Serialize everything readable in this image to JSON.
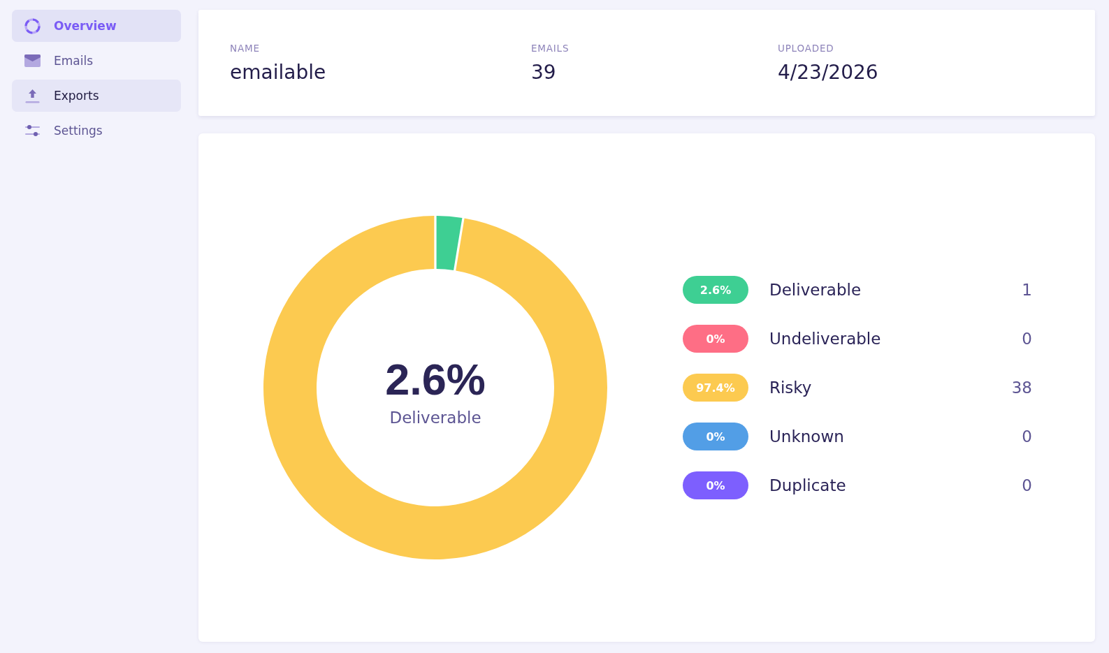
{
  "sidebar": {
    "items": [
      {
        "label": "Overview",
        "kind": "ring",
        "selected": true,
        "hovered": false
      },
      {
        "label": "Emails",
        "kind": "envelope",
        "selected": false,
        "hovered": false
      },
      {
        "label": "Exports",
        "kind": "upload",
        "selected": false,
        "hovered": true
      },
      {
        "label": "Settings",
        "kind": "sliders",
        "selected": false,
        "hovered": false
      }
    ]
  },
  "summary": {
    "fields": [
      {
        "label": "NAME",
        "value": "emailable"
      },
      {
        "label": "EMAILS",
        "value": "39"
      },
      {
        "label": "UPLOADED",
        "value": "4/23/2026"
      }
    ]
  },
  "breakdown": {
    "chart_data": {
      "type": "donut",
      "categories": [
        "Deliverable",
        "Undeliverable",
        "Risky",
        "Unknown",
        "Duplicate"
      ],
      "values": [
        2.6,
        0,
        97.4,
        0,
        0
      ]
    },
    "center_value": "2.6%",
    "center_label": "Deliverable",
    "legend": [
      {
        "percent": "2.6%",
        "count": "1",
        "color": "#3ecf93"
      },
      {
        "percent": "0%",
        "count": "0",
        "color": "#fe6e85"
      },
      {
        "percent": "97.4%",
        "count": "38",
        "color": "#fcca50"
      },
      {
        "percent": "0%",
        "count": "0",
        "color": "#529ee6"
      },
      {
        "percent": "0%",
        "count": "0",
        "color": "#7d5ffe"
      }
    ]
  }
}
